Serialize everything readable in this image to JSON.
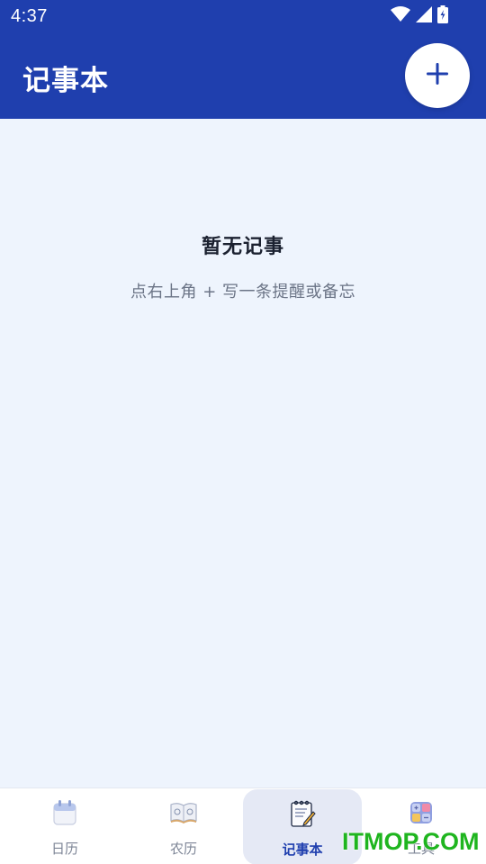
{
  "status_bar": {
    "time": "4:37",
    "icons": [
      "wifi-icon",
      "signal-icon",
      "battery-charging-icon"
    ]
  },
  "app_bar": {
    "title": "记事本",
    "add_button_icon": "plus-icon"
  },
  "empty_state": {
    "title": "暂无记事",
    "hint": "点右上角 + 写一条提醒或备忘"
  },
  "bottom_nav": {
    "items": [
      {
        "label": "日历",
        "icon": "calendar-icon",
        "active": false
      },
      {
        "label": "农历",
        "icon": "almanac-book-icon",
        "active": false
      },
      {
        "label": "记事本",
        "icon": "notepad-icon",
        "active": true
      },
      {
        "label": "工具",
        "icon": "tools-icon",
        "active": false
      }
    ]
  },
  "watermark": "ITMOP.COM",
  "colors": {
    "primary": "#1f3fae",
    "background": "#eef4fd",
    "watermark": "#1fb51f"
  }
}
